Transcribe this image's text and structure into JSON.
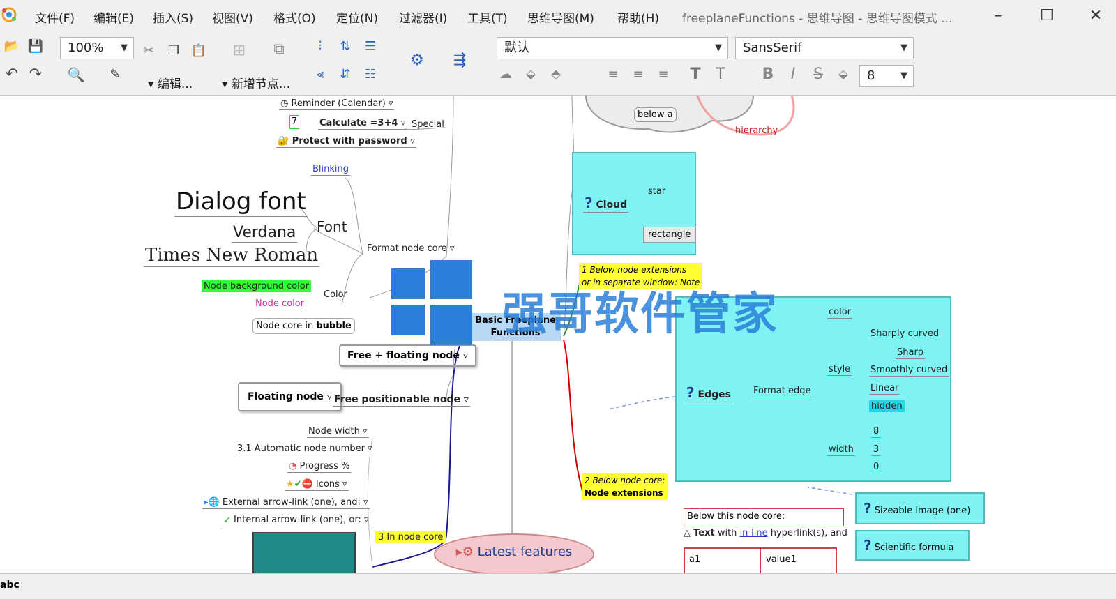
{
  "menu": {
    "items": [
      "文件(F)",
      "编辑(E)",
      "插入(S)",
      "视图(V)",
      "格式(O)",
      "定位(N)",
      "过滤器(I)",
      "工具(T)",
      "思维导图(M)",
      "帮助(H)"
    ],
    "window_title": "freeplaneFunctions - 思维导图 - 思维导图模式 ..."
  },
  "toolbar": {
    "zoom": "100%",
    "edit_label": "编辑...",
    "new_node_label": "新增节点...",
    "style_combo": "默认",
    "font_combo": "SansSerif",
    "size_combo": "8"
  },
  "map": {
    "reminder": "Reminder (Calendar)",
    "calc_badge": "7",
    "calculate": "Calculate =3+4",
    "protect": "Protect with password",
    "special": "Special",
    "blinking": "Blinking",
    "dialog_font": "Dialog font",
    "font": "Font",
    "verdana": "Verdana",
    "times": "Times New Roman",
    "format_node_core": "Format node core",
    "node_bg_color": "Node background color",
    "node_color": "Node color",
    "color": "Color",
    "bubble_pre": "Node core in ",
    "bubble_bold": "bubble",
    "free_floating": "Free + floating node",
    "floating": "Floating node",
    "free_positionable": "Free positionable node",
    "node_width": "Node width",
    "auto_number": "3.1 Automatic node number",
    "progress": "Progress %",
    "icons": "Icons",
    "external_link": "External arrow-link (one), and:",
    "internal_link": "Internal arrow-link (one), or:",
    "in_node_core": "3 In node core",
    "center_line1": "Basic Freeplane",
    "center_line2": "Functions",
    "latest": "Latest features",
    "below_a": "below a",
    "hierarchy": "hierarchy",
    "cloud": "Cloud",
    "star": "star",
    "rectangle": "rectangle",
    "note1_line1": "1 Below node extensions",
    "note1_line2": "or in separate window: Note",
    "color_label": "color",
    "sharply": "Sharply curved",
    "sharp": "Sharp",
    "smoothly": "Smoothly curved",
    "style": "style",
    "linear": "Linear",
    "hidden": "hidden",
    "edges": "Edges",
    "format_edge": "Format edge",
    "w8": "8",
    "w3": "3",
    "w0": "0",
    "width": "width",
    "note2_line1": "2 Below node core:",
    "note2_line2": "Node extensions",
    "below_core": "Below this node core:",
    "text_line_pre": "Text",
    "text_line_mid": " with ",
    "inline": "in-line",
    "text_line_post": " hyperlink(s), and",
    "a1": "a1",
    "value1": "value1",
    "sizeable": "Sizeable image (one)",
    "scientific": "Scientific formula"
  },
  "watermark": {
    "text": "强哥软件管家"
  },
  "status": {
    "abc": "abc"
  },
  "colors": {
    "cyan_node": "#7ff3f3",
    "yellow_note": "#ffff33",
    "green_bg": "#33ff33",
    "edge_red": "#d10000",
    "edge_blue": "#1a1a8c"
  }
}
